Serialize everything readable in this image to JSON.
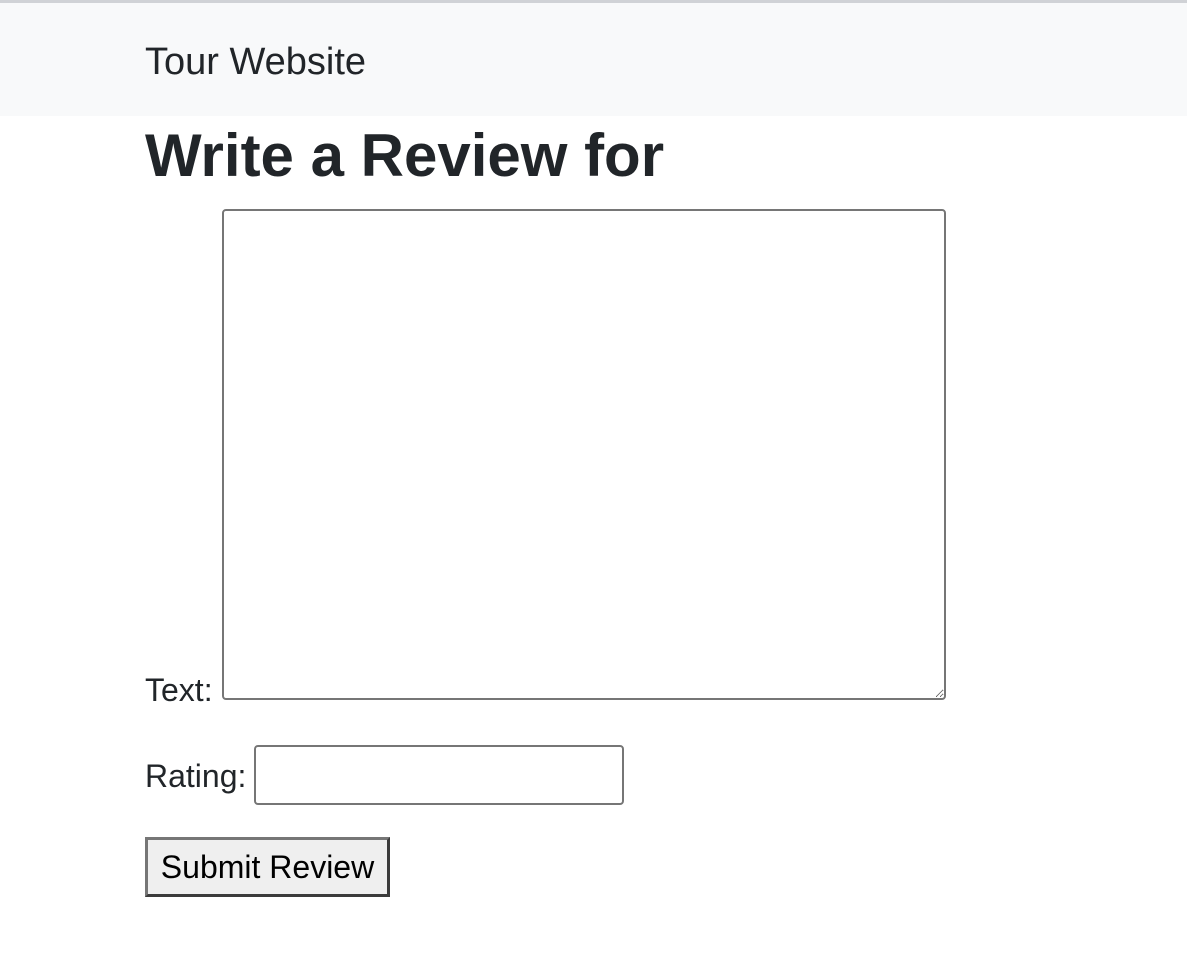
{
  "navbar": {
    "brand": "Tour Website"
  },
  "page": {
    "title": "Write a Review for"
  },
  "form": {
    "text_label": "Text:",
    "text_value": "",
    "rating_label": "Rating:",
    "rating_value": "",
    "submit_label": "Submit Review"
  },
  "colors": {
    "navbar_background": "#f8f9fa",
    "text": "#212529",
    "field_border": "#767676",
    "button_background": "#efefef"
  }
}
